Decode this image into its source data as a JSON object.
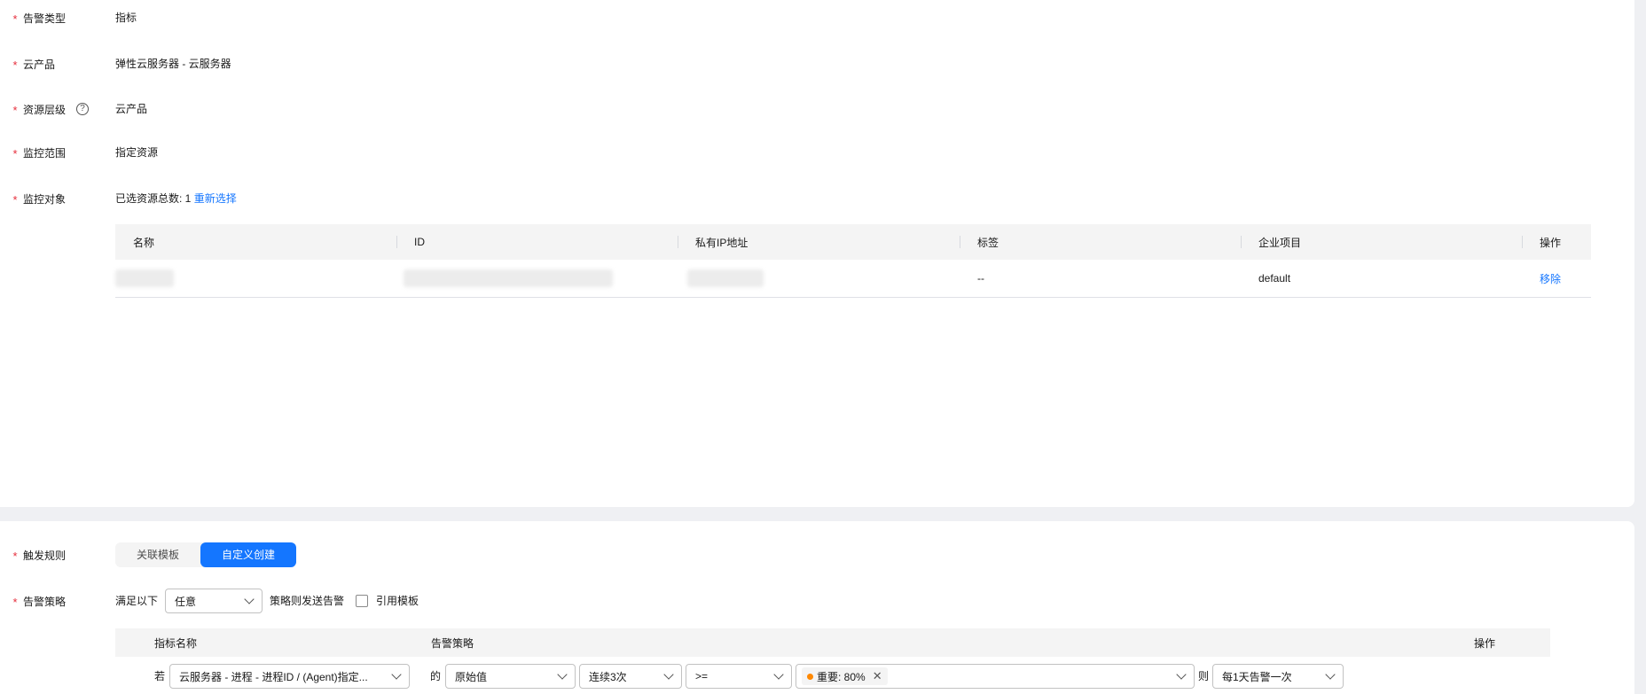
{
  "fields": {
    "alarm_type": {
      "label": "告警类型",
      "value": "指标"
    },
    "cloud_product": {
      "label": "云产品",
      "value": "弹性云服务器 - 云服务器"
    },
    "resource_level": {
      "label": "资源层级",
      "value": "云产品",
      "help": "?"
    },
    "monitor_scope": {
      "label": "监控范围",
      "value": "指定资源"
    },
    "monitor_object": {
      "label": "监控对象",
      "prefix": "已选资源总数: 1",
      "reselect": "重新选择"
    }
  },
  "resource_table": {
    "columns": [
      "名称",
      "ID",
      "私有IP地址",
      "标签",
      "企业项目",
      "操作"
    ],
    "rows": [
      {
        "tag": "--",
        "enterprise_project": "default",
        "action": "移除"
      }
    ]
  },
  "trigger": {
    "label": "触发规则",
    "tabs": [
      "关联模板",
      "自定义创建"
    ],
    "active_tab": "自定义创建"
  },
  "policy": {
    "label": "告警策略",
    "prefix": "满足以下",
    "condition": "任意",
    "suffix": "策略则发送告警",
    "use_template": "引用模板",
    "columns": [
      "指标名称",
      "告警策略",
      "操作"
    ],
    "row": {
      "if_label": "若",
      "metric": "云服务器 - 进程 - 进程ID / (Agent)指定...",
      "of_label": "的",
      "value_type": "原始值",
      "period": "连续3次",
      "operator": ">=",
      "threshold": "重要: 80%",
      "then_label": "则",
      "frequency": "每1天告警一次"
    }
  },
  "colors": {
    "accent": "#1476ff",
    "required": "#e62e3c",
    "major": "#ff8800"
  }
}
